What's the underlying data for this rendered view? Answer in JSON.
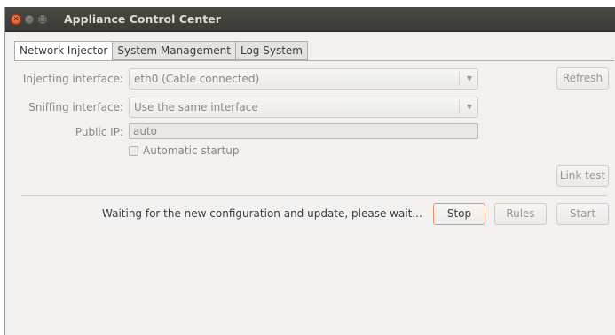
{
  "window": {
    "title": "Appliance Control Center"
  },
  "tabs": [
    {
      "label": "Network Injector",
      "active": true
    },
    {
      "label": "System Management",
      "active": false
    },
    {
      "label": "Log System",
      "active": false
    }
  ],
  "injector": {
    "injecting_label": "Injecting interface:",
    "injecting_value": "eth0 (Cable connected)",
    "sniffing_label": "Sniffing interface:",
    "sniffing_value": "Use the same interface",
    "public_ip_label": "Public IP:",
    "public_ip_value": "auto",
    "auto_startup_label": "Automatic startup",
    "auto_startup_checked": false,
    "refresh_label": "Refresh",
    "link_test_label": "Link test",
    "status_text": "Waiting for the new configuration and update, please wait...",
    "stop_label": "Stop",
    "rules_label": "Rules",
    "start_label": "Start"
  },
  "icons": {
    "close": "close-icon",
    "minimize": "minimize-icon",
    "maximize": "maximize-icon",
    "dropdown": "chevron-down-icon"
  },
  "colors": {
    "titlebar": "#3c3b37",
    "close_button": "#e5561e",
    "focus_border": "#e9926a",
    "window_bg": "#f2f1f0"
  }
}
